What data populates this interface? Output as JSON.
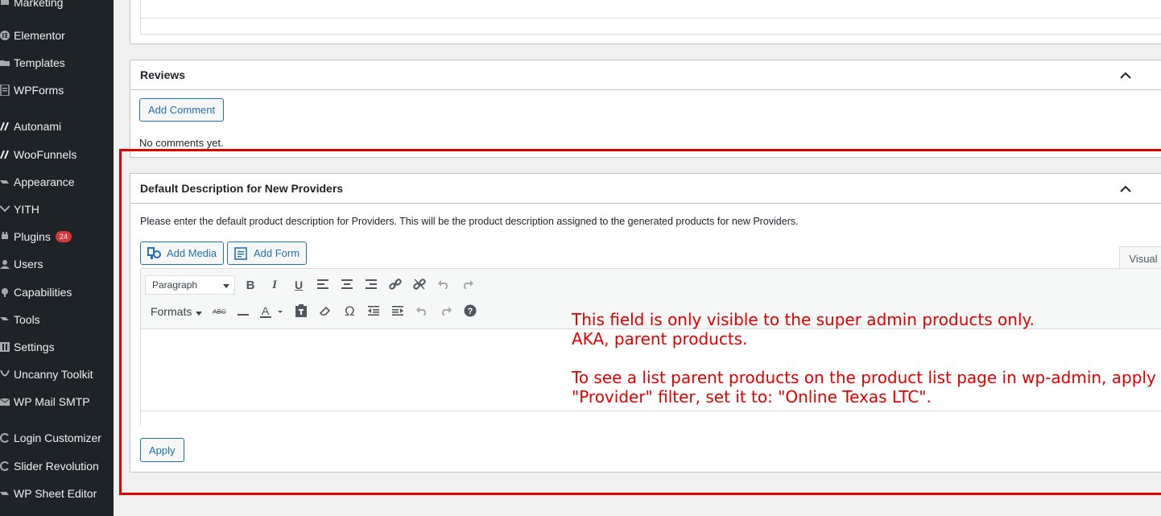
{
  "sidebar": {
    "items": [
      {
        "label": "Marketing",
        "icon": "megaphone-icon"
      },
      {
        "label": "Elementor",
        "icon": "elementor-icon"
      },
      {
        "label": "Templates",
        "icon": "folder-icon"
      },
      {
        "label": "WPForms",
        "icon": "form-icon"
      },
      {
        "label": "Autonami",
        "icon": "autonami-icon"
      },
      {
        "label": "WooFunnels",
        "icon": "woofunnels-icon"
      },
      {
        "label": "Appearance",
        "icon": "brush-icon"
      },
      {
        "label": "YITH",
        "icon": "yith-icon"
      },
      {
        "label": "Plugins",
        "icon": "plugin-icon",
        "badge": "24"
      },
      {
        "label": "Users",
        "icon": "users-icon"
      },
      {
        "label": "Capabilities",
        "icon": "key-icon"
      },
      {
        "label": "Tools",
        "icon": "wrench-icon"
      },
      {
        "label": "Settings",
        "icon": "settings-icon"
      },
      {
        "label": "Uncanny Toolkit",
        "icon": "uncanny-icon"
      },
      {
        "label": "WP Mail SMTP",
        "icon": "mail-icon"
      },
      {
        "label": "Login Customizer",
        "icon": "login-icon"
      },
      {
        "label": "Slider Revolution",
        "icon": "slider-icon"
      },
      {
        "label": "WP Sheet Editor",
        "icon": "sheet-icon"
      }
    ]
  },
  "reviews": {
    "title": "Reviews",
    "add_comment": "Add Comment",
    "no_comments": "No comments yet."
  },
  "provider_box": {
    "title": "Default Description for New Providers",
    "description": "Please enter the default product description for Providers. This will be the product description assigned to the generated products for new Providers.",
    "add_media": "Add Media",
    "add_form": "Add Form",
    "visual_tab": "Visual",
    "paragraph_select": "Paragraph",
    "formats_label": "Formats",
    "apply": "Apply"
  },
  "annotation": {
    "line1": "This field is only visible to the super admin products only.",
    "line2": "AKA, parent products.",
    "line3": "To see a list parent products on the product list page in wp-admin, apply",
    "line4": "\"Provider\" filter, set it to: \"Online Texas LTC\"."
  },
  "colors": {
    "sidebar_bg": "#1d2327",
    "accent": "#2271b1",
    "annotation_red": "#e00000",
    "badge": "#d63638"
  }
}
